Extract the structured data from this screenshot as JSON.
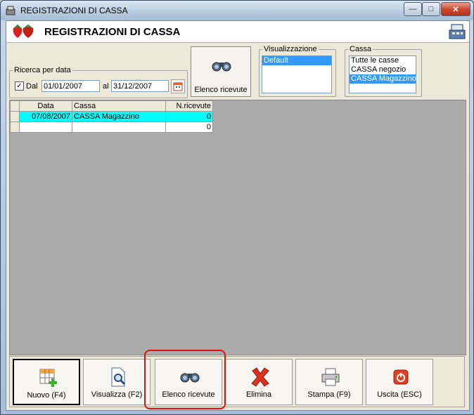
{
  "window": {
    "title": "REGISTRAZIONI DI CASSA",
    "minimize": "—",
    "maximize": "□",
    "close": "✕"
  },
  "header": {
    "title": "REGISTRAZIONI DI CASSA"
  },
  "search_group": {
    "legend": "Ricerca per data",
    "checkbox_checked": true,
    "check_mark": "✓",
    "from_label": "Dal",
    "from_date": "01/01/2007",
    "to_label": "al",
    "to_date": "31/12/2007"
  },
  "elenco_button": {
    "label": "Elenco ricevute"
  },
  "visualizzazione": {
    "legend": "Visualizzazione",
    "options": [
      "Default"
    ],
    "selected": 0
  },
  "cassa": {
    "legend": "Cassa",
    "options": [
      "Tutte le casse",
      "CASSA negozio",
      "CASSA Magazzino"
    ],
    "selected": 2
  },
  "grid": {
    "columns": [
      "Data",
      "Cassa",
      "N.ricevute"
    ],
    "rows": [
      {
        "data": "07/08/2007",
        "cassa": "CASSA Magazzino",
        "n": "0"
      },
      {
        "data": "",
        "cassa": "",
        "n": "0"
      }
    ]
  },
  "bottom_buttons": [
    {
      "label": "Nuovo (F4)"
    },
    {
      "label": "Visualizza (F2)"
    },
    {
      "label": "Elenco ricevute"
    },
    {
      "label": "Elimina"
    },
    {
      "label": "Stampa (F9)"
    },
    {
      "label": "Uscita (ESC)"
    }
  ],
  "colors": {
    "selected_row": "#00ffff",
    "list_selection": "#3399ff",
    "highlight": "#e01010"
  }
}
